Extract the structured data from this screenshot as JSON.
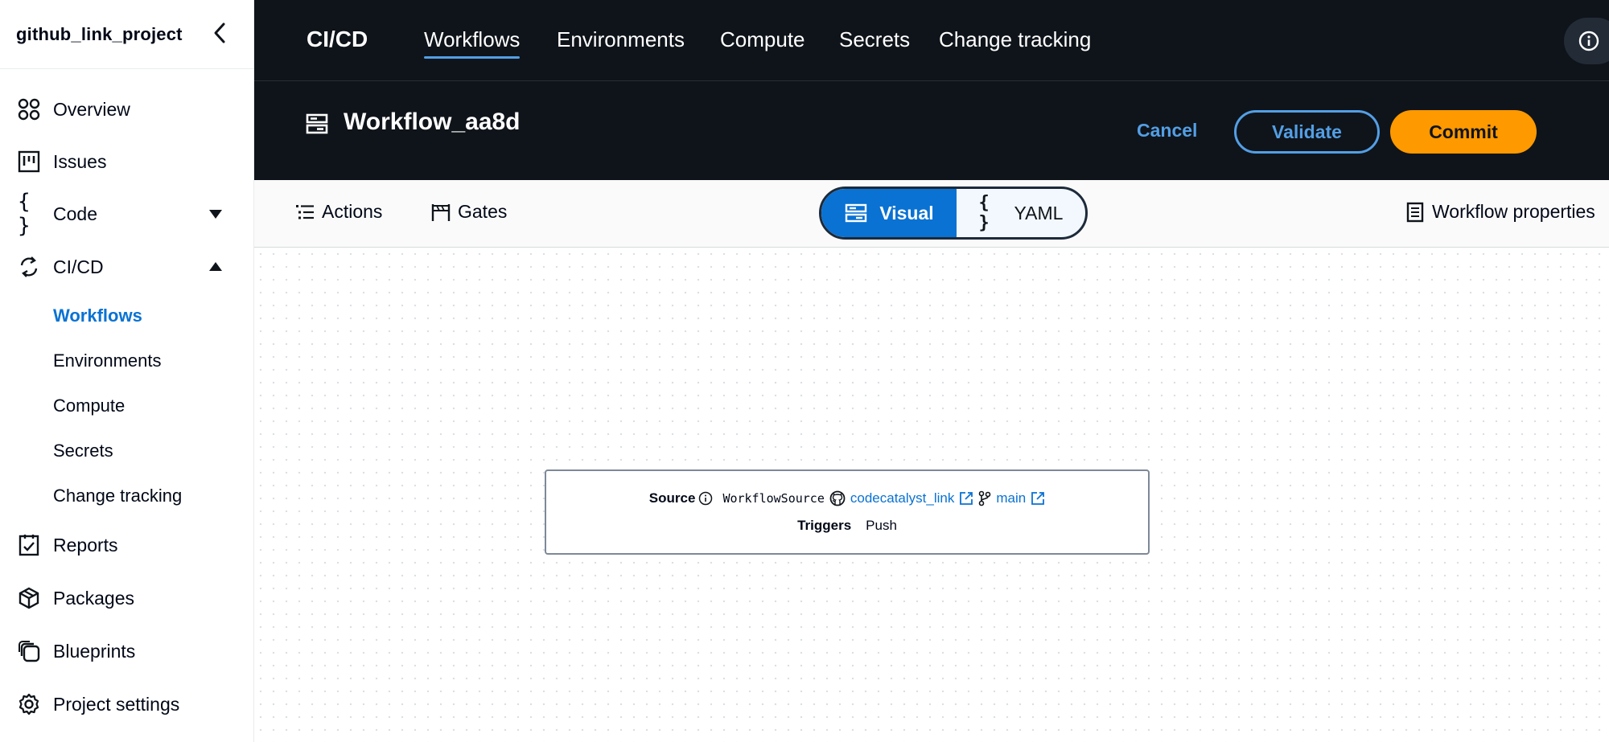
{
  "sidebar": {
    "project_name": "github_link_project",
    "items": [
      {
        "label": "Overview",
        "icon": "overview-icon"
      },
      {
        "label": "Issues",
        "icon": "issues-icon"
      },
      {
        "label": "Code",
        "icon": "code-icon"
      },
      {
        "label": "CI/CD",
        "icon": "cicd-icon"
      },
      {
        "label": "Reports",
        "icon": "reports-icon"
      },
      {
        "label": "Packages",
        "icon": "packages-icon"
      },
      {
        "label": "Blueprints",
        "icon": "blueprints-icon"
      },
      {
        "label": "Project settings",
        "icon": "settings-icon"
      }
    ],
    "cicd_subitems": [
      {
        "label": "Workflows",
        "active": true
      },
      {
        "label": "Environments"
      },
      {
        "label": "Compute"
      },
      {
        "label": "Secrets"
      },
      {
        "label": "Change tracking"
      }
    ]
  },
  "topnav": {
    "brand": "CI/CD",
    "tabs": [
      {
        "label": "Workflows",
        "active": true
      },
      {
        "label": "Environments"
      },
      {
        "label": "Compute"
      },
      {
        "label": "Secrets"
      },
      {
        "label": "Change tracking"
      }
    ]
  },
  "header": {
    "title": "Workflow_aa8d",
    "cancel_label": "Cancel",
    "validate_label": "Validate",
    "commit_label": "Commit"
  },
  "toolbar": {
    "actions_label": "Actions",
    "gates_label": "Gates",
    "visual_label": "Visual",
    "yaml_label": "YAML",
    "properties_label": "Workflow properties"
  },
  "source_card": {
    "source_label": "Source",
    "source_name": "WorkflowSource",
    "repo_link": "codecatalyst_link",
    "branch_link": "main",
    "triggers_label": "Triggers",
    "trigger_value": "Push"
  },
  "colors": {
    "accent_blue": "#0972d3",
    "header_bg": "#0f141a",
    "commit_orange": "#ff9900",
    "link_blue_dark": "#539fe5"
  }
}
